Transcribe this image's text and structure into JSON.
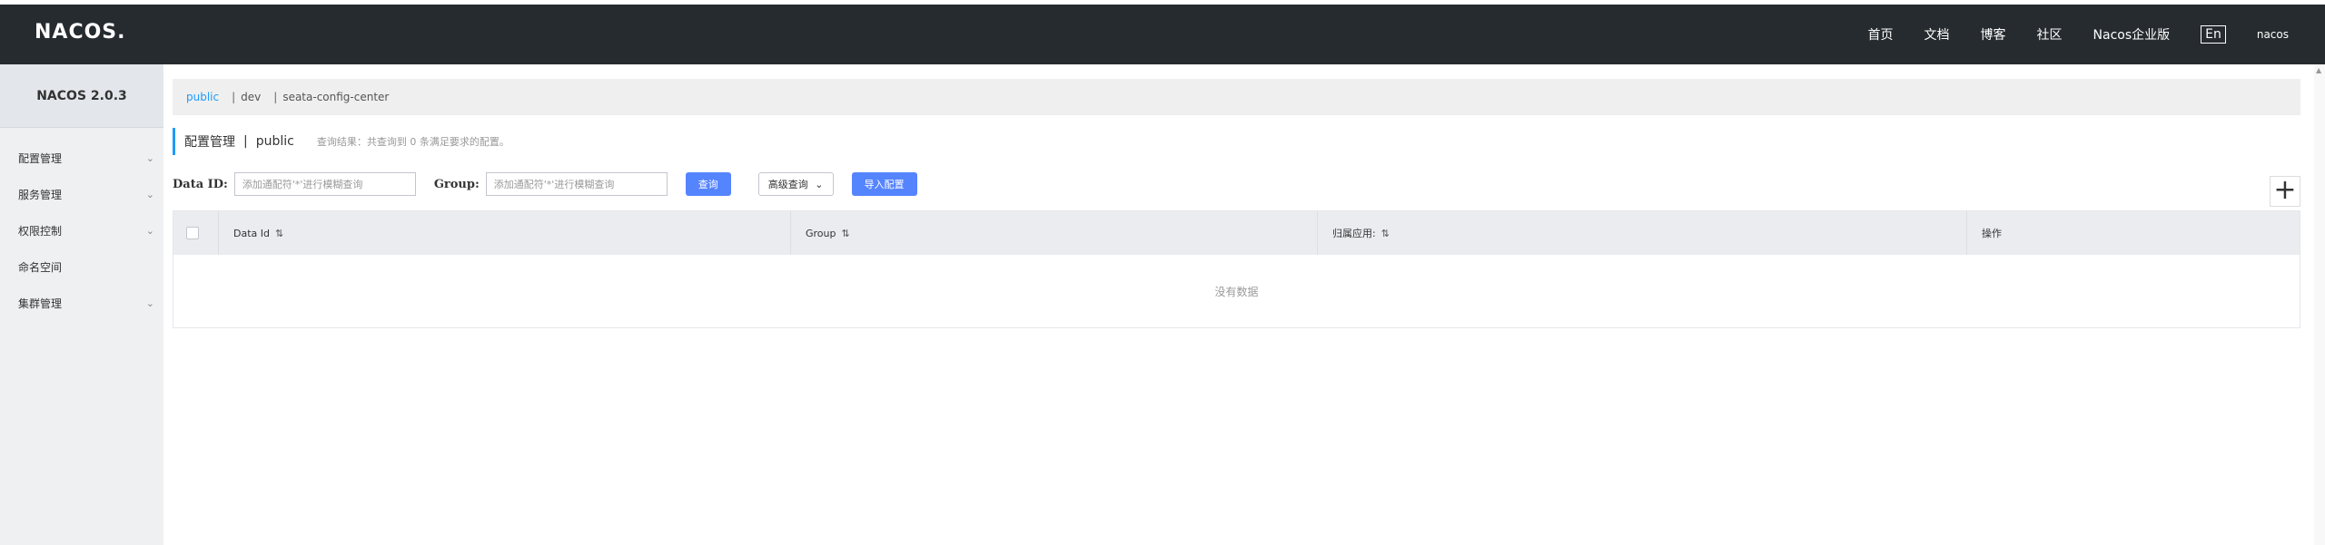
{
  "header": {
    "logo": "NACOS.",
    "nav": [
      "首页",
      "文档",
      "博客",
      "社区",
      "Nacos企业版"
    ],
    "lang": "En",
    "user": "nacos"
  },
  "sidebar": {
    "version": "NACOS 2.0.3",
    "items": [
      {
        "label": "配置管理",
        "expandable": true
      },
      {
        "label": "服务管理",
        "expandable": true
      },
      {
        "label": "权限控制",
        "expandable": true
      },
      {
        "label": "命名空间",
        "expandable": false
      },
      {
        "label": "集群管理",
        "expandable": true
      }
    ]
  },
  "namespaces": {
    "items": [
      "public",
      "dev",
      "seata-config-center"
    ],
    "active": "public"
  },
  "title": {
    "main": "配置管理",
    "separator": "|",
    "namespace": "public",
    "hint": "查询结果：共查询到 0 条满足要求的配置。"
  },
  "search": {
    "data_id_label": "Data ID:",
    "data_id_placeholder": "添加通配符'*'进行模糊查询",
    "group_label": "Group:",
    "group_placeholder": "添加通配符'*'进行模糊查询",
    "query_button": "查询",
    "advanced_button": "高级查询",
    "import_button": "导入配置"
  },
  "table": {
    "columns": [
      "Data Id",
      "Group",
      "归属应用:",
      "操作"
    ],
    "empty_text": "没有数据"
  },
  "colors": {
    "header_bg": "#262b2f",
    "accent": "#209bfa",
    "primary_button": "#5584ff"
  }
}
